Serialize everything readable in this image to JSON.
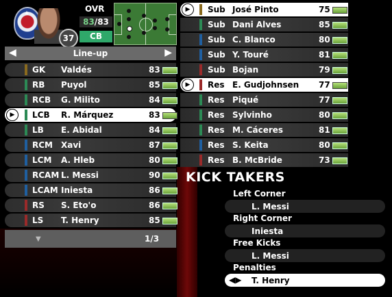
{
  "player": {
    "rating": "37",
    "ovr_label": "OVR",
    "ovr_current": "83",
    "ovr_max": "83",
    "position": "CB"
  },
  "lineup": {
    "title": "Line-up",
    "left_arrow": "◀",
    "right_arrow": "▶",
    "rows": [
      {
        "pos": "GK",
        "name": "Valdés",
        "ovr": "83",
        "color": "#8a6a1e"
      },
      {
        "pos": "RB",
        "name": "Puyol",
        "ovr": "85",
        "color": "#2c8a55"
      },
      {
        "pos": "RCB",
        "name": "G. Milito",
        "ovr": "84",
        "color": "#2c8a55"
      },
      {
        "pos": "LCB",
        "name": "R. Márquez",
        "ovr": "83",
        "color": "#2c8a55",
        "selected": true
      },
      {
        "pos": "LB",
        "name": "E. Abidal",
        "ovr": "84",
        "color": "#2c8a55"
      },
      {
        "pos": "RCM",
        "name": "Xavi",
        "ovr": "87",
        "color": "#1f5fa0"
      },
      {
        "pos": "LCM",
        "name": "A. Hleb",
        "ovr": "80",
        "color": "#1f5fa0"
      },
      {
        "pos": "RCAM",
        "name": "L. Messi",
        "ovr": "90",
        "color": "#1f5fa0"
      },
      {
        "pos": "LCAM",
        "name": "Iniesta",
        "ovr": "86",
        "color": "#1f5fa0"
      },
      {
        "pos": "RS",
        "name": "S. Eto'o",
        "ovr": "86",
        "color": "#9a2a2a"
      },
      {
        "pos": "LS",
        "name": "T. Henry",
        "ovr": "85",
        "color": "#9a2a2a"
      }
    ],
    "page": "1/3"
  },
  "bench": [
    {
      "pos": "Sub",
      "name": "José Pinto",
      "ovr": "75",
      "color": "#8a6a1e",
      "selected": true
    },
    {
      "pos": "Sub",
      "name": "Dani Alves",
      "ovr": "85",
      "color": "#2c8a55"
    },
    {
      "pos": "Sub",
      "name": "C. Blanco",
      "ovr": "80",
      "color": "#1f5fa0"
    },
    {
      "pos": "Sub",
      "name": "Y. Touré",
      "ovr": "81",
      "color": "#1f5fa0"
    },
    {
      "pos": "Sub",
      "name": "Bojan",
      "ovr": "79",
      "color": "#9a2a2a"
    },
    {
      "pos": "Res",
      "name": "E. Gudjohnsen",
      "ovr": "77",
      "color": "#9a2a2a",
      "selected": true
    },
    {
      "pos": "Res",
      "name": "Piqué",
      "ovr": "77",
      "color": "#2c8a55"
    },
    {
      "pos": "Res",
      "name": "Sylvinho",
      "ovr": "80",
      "color": "#2c8a55"
    },
    {
      "pos": "Res",
      "name": "M. Cáceres",
      "ovr": "81",
      "color": "#2c8a55"
    },
    {
      "pos": "Res",
      "name": "S. Keita",
      "ovr": "80",
      "color": "#1f5fa0"
    },
    {
      "pos": "Res",
      "name": "B. McBride",
      "ovr": "73",
      "color": "#9a2a2a"
    }
  ],
  "kick_takers": {
    "title": "KICK TAKERS",
    "left_corner_label": "Left Corner",
    "left_corner": "L. Messi",
    "right_corner_label": "Right Corner",
    "right_corner": "Iniesta",
    "free_kicks_label": "Free Kicks",
    "free_kicks": "L. Messi",
    "penalties_label": "Penalties",
    "penalties": "T. Henry"
  }
}
